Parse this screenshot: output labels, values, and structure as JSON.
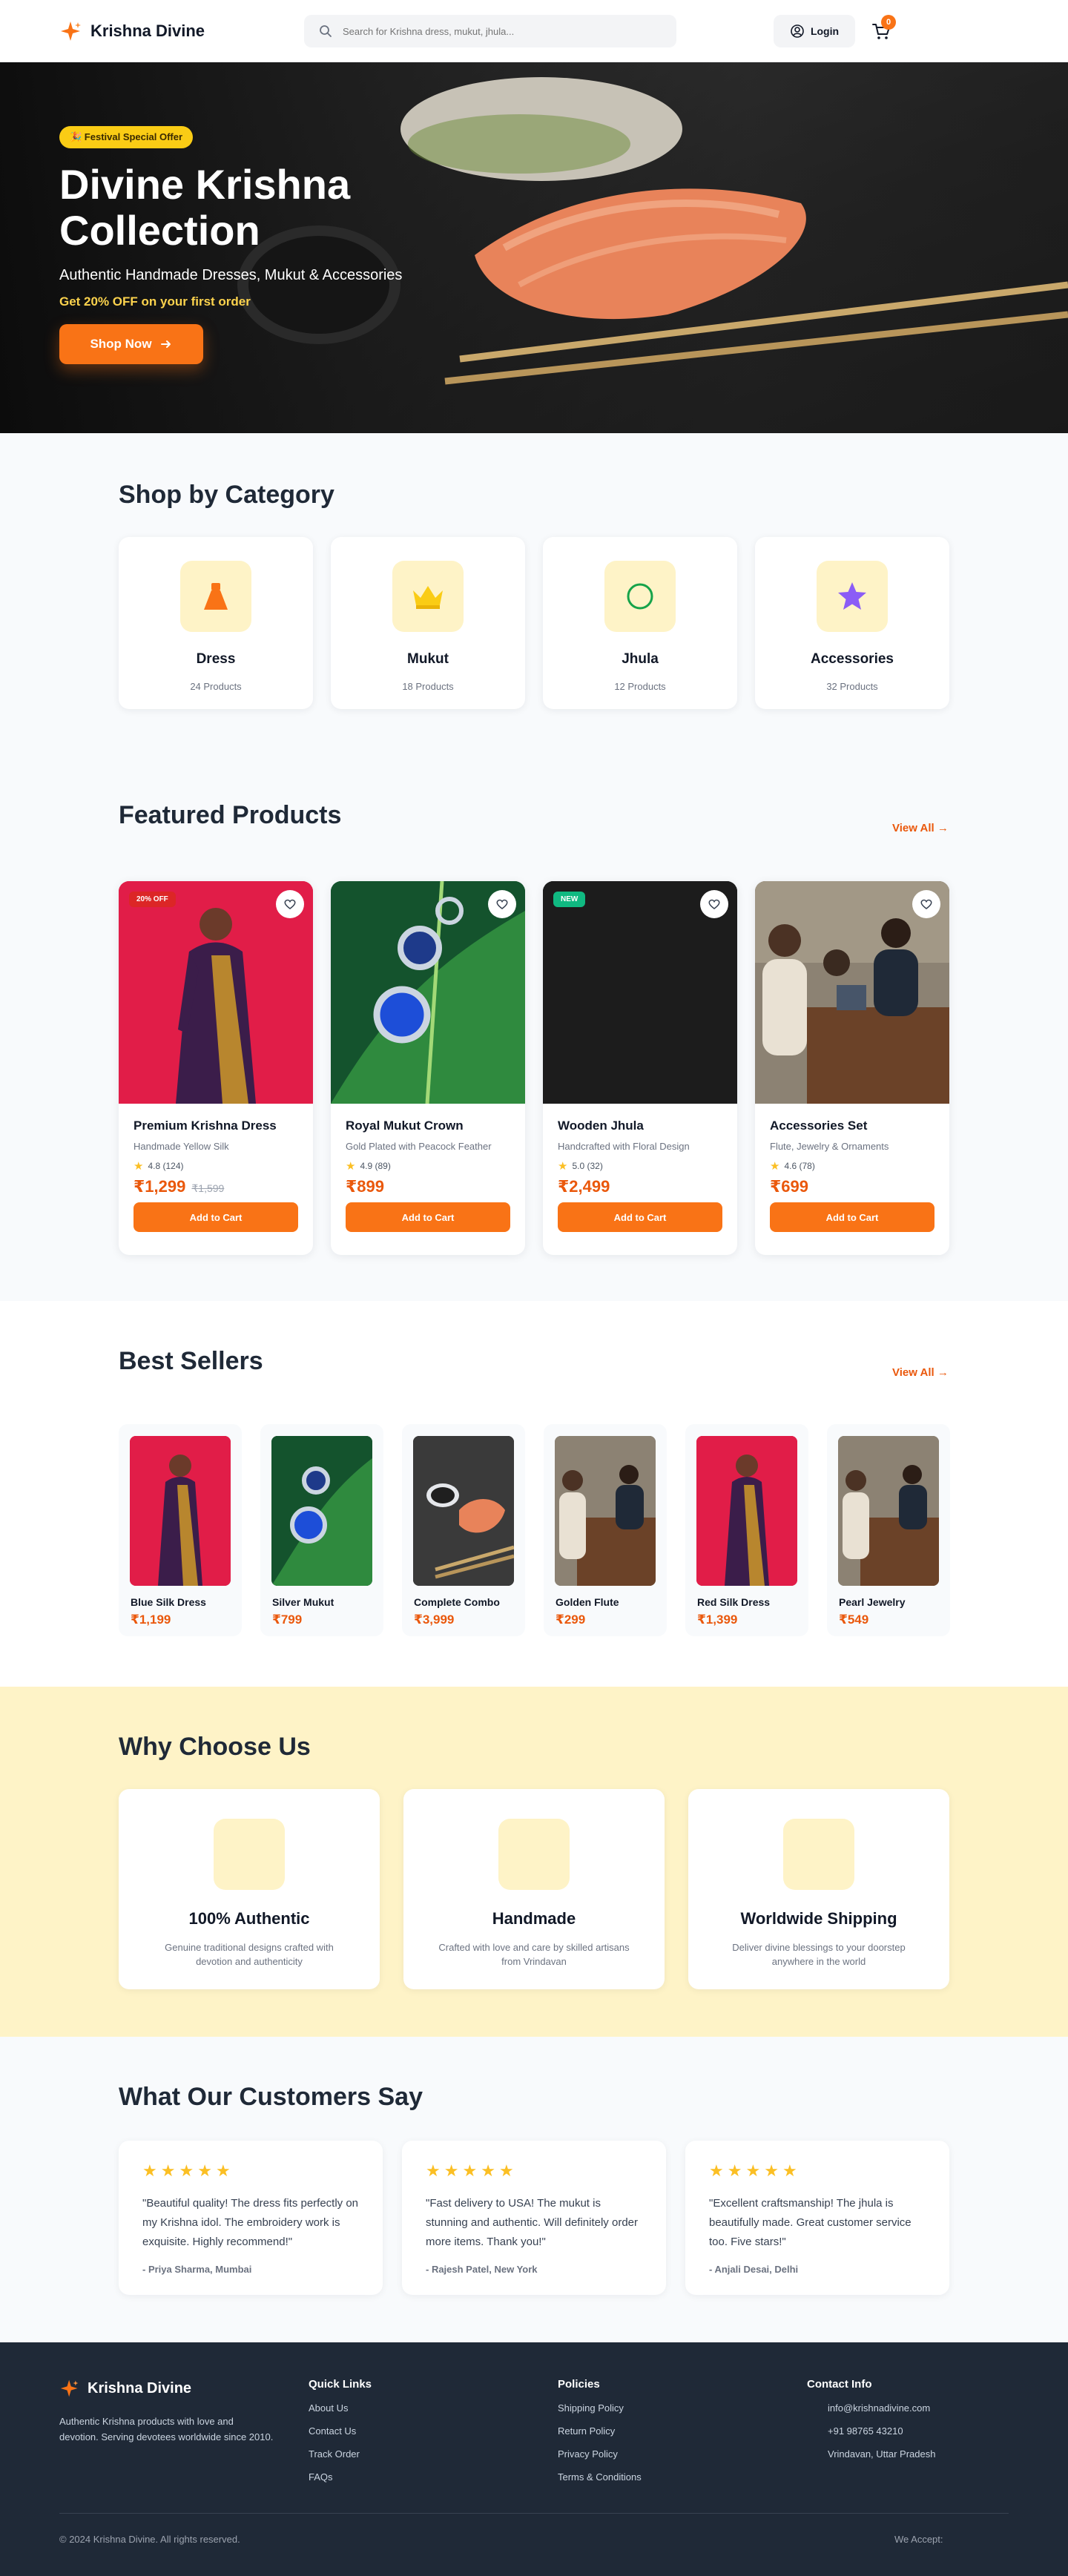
{
  "brand": {
    "name": "Krishna Divine",
    "accent": "#f97316"
  },
  "search": {
    "placeholder": "Search for Krishna dress, mukut, jhula..."
  },
  "header": {
    "login": "Login",
    "cart_count": "0"
  },
  "hero": {
    "badge": "🎉 Festival Special Offer",
    "title_line1": "Divine Krishna",
    "title_line2": "Collection",
    "subtitle": "Authentic Handmade Dresses, Mukut & Accessories",
    "offer": "Get 20% OFF on your first order",
    "cta": "Shop Now"
  },
  "categories": {
    "title": "Shop by Category",
    "items": [
      {
        "name": "Dress",
        "count": "24 Products",
        "icon": "dress-icon"
      },
      {
        "name": "Mukut",
        "count": "18 Products",
        "icon": "crown-icon"
      },
      {
        "name": "Jhula",
        "count": "12 Products",
        "icon": "circle-icon"
      },
      {
        "name": "Accessories",
        "count": "32 Products",
        "icon": "star-icon"
      }
    ]
  },
  "featured": {
    "title": "Featured Products",
    "view_all": "View All →",
    "add_label": "Add to Cart",
    "items": [
      {
        "tag": "20% OFF",
        "name": "Premium Krishna Dress",
        "desc": "Handmade Yellow Silk",
        "rating": "4.8 (124)",
        "price": "₹1,299",
        "old_price": "₹1,599"
      },
      {
        "tag": "",
        "name": "Royal Mukut Crown",
        "desc": "Gold Plated with Peacock Feather",
        "rating": "4.9 (89)",
        "price": "₹899",
        "old_price": ""
      },
      {
        "tag": "NEW",
        "name": "Wooden Jhula",
        "desc": "Handcrafted with Floral Design",
        "rating": "5.0 (32)",
        "price": "₹2,499",
        "old_price": ""
      },
      {
        "tag": "",
        "name": "Accessories Set",
        "desc": "Flute, Jewelry & Ornaments",
        "rating": "4.6 (78)",
        "price": "₹699",
        "old_price": ""
      }
    ]
  },
  "best": {
    "title": "Best Sellers",
    "view_all": "View All →",
    "items": [
      {
        "name": "Blue Silk Dress",
        "price": "₹1,199"
      },
      {
        "name": "Silver Mukut",
        "price": "₹799"
      },
      {
        "name": "Complete Combo",
        "price": "₹3,999"
      },
      {
        "name": "Golden Flute",
        "price": "₹299"
      },
      {
        "name": "Red Silk Dress",
        "price": "₹1,399"
      },
      {
        "name": "Pearl Jewelry",
        "price": "₹549"
      }
    ]
  },
  "why": {
    "title": "Why Choose Us",
    "items": [
      {
        "name": "100% Authentic",
        "desc": "Genuine traditional designs crafted with devotion and authenticity"
      },
      {
        "name": "Handmade",
        "desc": "Crafted with love and care by skilled artisans from Vrindavan"
      },
      {
        "name": "Worldwide Shipping",
        "desc": "Deliver divine blessings to your doorstep anywhere in the world"
      }
    ]
  },
  "testimonials": {
    "title": "What Our Customers Say",
    "items": [
      {
        "quote": "\"Beautiful quality! The dress fits perfectly on my Krishna idol. The embroidery work is exquisite. Highly recommend!\"",
        "author": "- Priya Sharma, Mumbai"
      },
      {
        "quote": "\"Fast delivery to USA! The mukut is stunning and authentic. Will definitely order more items. Thank you!\"",
        "author": "- Rajesh Patel, New York"
      },
      {
        "quote": "\"Excellent craftsmanship! The jhula is beautifully made. Great customer service too. Five stars!\"",
        "author": "- Anjali Desai, Delhi"
      }
    ]
  },
  "footer": {
    "about": "Authentic Krishna products with love and devotion. Serving devotees worldwide since 2010.",
    "quick_title": "Quick Links",
    "quick": [
      "About Us",
      "Contact Us",
      "Track Order",
      "FAQs"
    ],
    "policy_title": "Policies",
    "policies": [
      "Shipping Policy",
      "Return Policy",
      "Privacy Policy",
      "Terms & Conditions"
    ],
    "contact_title": "Contact Info",
    "email": "info@krishnadivine.com",
    "phone": "+91 98765 43210",
    "address": "Vrindavan, Uttar Pradesh",
    "copyright": "© 2024 Krishna Divine. All rights reserved.",
    "accept": "We Accept:"
  }
}
